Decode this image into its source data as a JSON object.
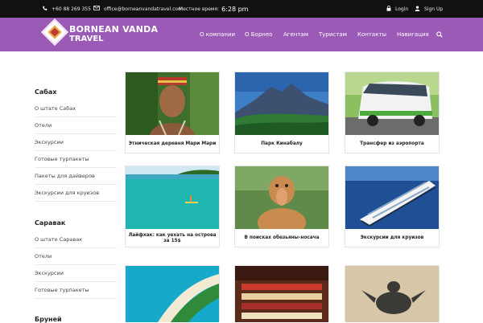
{
  "topbar": {
    "phone": "+60 88 269 355",
    "email": "office@borneanvandatravel.com",
    "time_label": "Местное время:",
    "time_value": "6:28 pm",
    "login": "Login",
    "signup": "Sign Up"
  },
  "brand": {
    "line1": "BORNEAN VANDA",
    "line2": "TRAVEL"
  },
  "nav": [
    "О компании",
    "О Борнео",
    "Агентам",
    "Туристам",
    "Контакты",
    "Навигация"
  ],
  "sidebar": [
    {
      "heading": "Сабах",
      "items": [
        "О штате Сабах",
        "Отели",
        "Экскурсии",
        "Готовые турпакеты",
        "Пакеты для дайверов",
        "Экскурсии для круизов"
      ]
    },
    {
      "heading": "Саравак",
      "items": [
        "О штате Саравак",
        "Отели",
        "Экскурсии",
        "Готовые турпакеты"
      ]
    },
    {
      "heading": "Бруней",
      "items": []
    }
  ],
  "cards": [
    {
      "caption": "Этническая деревня Мари Мари",
      "image": "tribal-man-photo"
    },
    {
      "caption": "Парк Кинабалу",
      "image": "mountain-photo"
    },
    {
      "caption": "Трансфер из аэропорта",
      "image": "minivan-photo"
    },
    {
      "caption": "Лайфхак: как уехать на острова за 15$",
      "image": "island-lagoon-photo"
    },
    {
      "caption": "В поисках обезьяны-носача",
      "image": "proboscis-monkey-photo"
    },
    {
      "caption": "Экскурсии для круизов",
      "image": "cruise-ship-photo"
    },
    {
      "caption": "",
      "image": "aerial-island-photo"
    },
    {
      "caption": "",
      "image": "market-stall-photo"
    },
    {
      "caption": "",
      "image": "sea-turtle-photo"
    }
  ],
  "colors": {
    "brand_purple": "#9b5ab5",
    "topbar": "#111111"
  }
}
